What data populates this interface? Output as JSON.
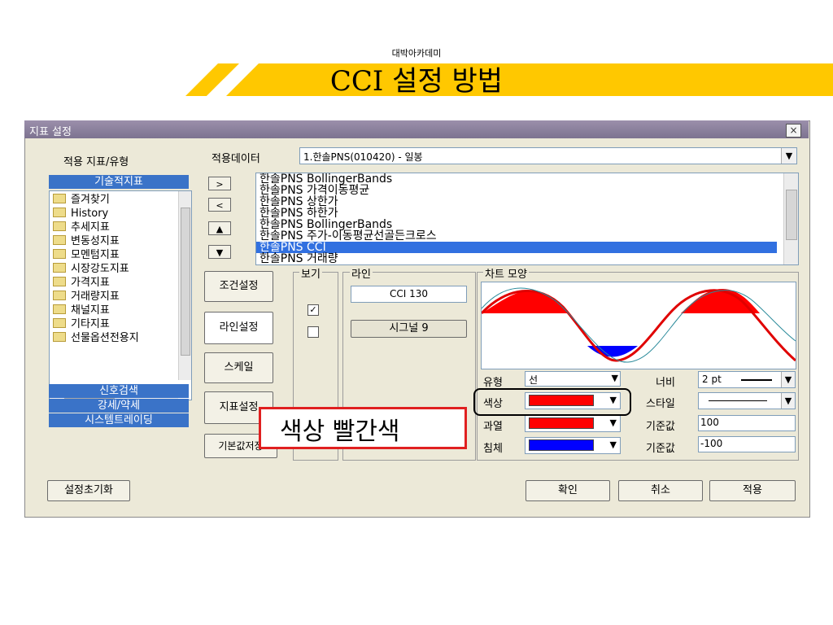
{
  "header": {
    "academy": "대박아카데미",
    "title": "CCI 설정 방법",
    "accent_color": "#FFC800"
  },
  "dialog": {
    "title": "지표 설정",
    "close_label": "×",
    "left_heading": "적용 지표/유형",
    "apply_data_label": "적용데이터",
    "apply_data_value": "1.한솔PNS(010420) - 일봉",
    "category_tabs": [
      "기술적지표",
      "신호검색",
      "강세/약세",
      "시스템트레이딩"
    ],
    "tree_items": [
      "즐겨찾기",
      "History",
      "추세지표",
      "변동성지표",
      "모멘텀지표",
      "시장강도지표",
      "가격지표",
      "거래량지표",
      "채널지표",
      "기타지표",
      "선물옵션전용지"
    ],
    "nav_buttons": [
      ">",
      "<",
      "▲",
      "▼"
    ],
    "indicator_list": [
      "한솔PNS BollingerBands",
      "한솔PNS 가격이동평균",
      "한솔PNS 상한가",
      "한솔PNS 하한가",
      "한솔PNS BollingerBands",
      "한솔PNS 주가-이동평균선골든크로스",
      "한솔PNS CCI",
      "한솔PNS 거래량"
    ],
    "selected_index": 6,
    "side_buttons": [
      "조건설정",
      "라인설정",
      "스케일",
      "지표설정",
      "기본값저장"
    ],
    "view_group": "보기",
    "line_group": "라인",
    "line_items": [
      "CCI 130",
      "시그널 9"
    ],
    "chart_group": "차트 모양",
    "props": {
      "type_label": "유형",
      "type_value": "선",
      "width_label": "너비",
      "width_value": "2 pt",
      "color_label": "색상",
      "style_label": "스타일",
      "over_label": "과열",
      "over_base_label": "기준값",
      "over_base_value": "100",
      "under_label": "침체",
      "under_base_label": "기준값",
      "under_base_value": "-100"
    },
    "colors": {
      "color": "#ff0000",
      "over": "#ff0000",
      "under": "#0000ff"
    },
    "reset_button": "설정초기화",
    "ok_button": "확인",
    "cancel_button": "취소",
    "apply_button": "적용"
  },
  "annotation": {
    "text": "색상 빨간색"
  }
}
